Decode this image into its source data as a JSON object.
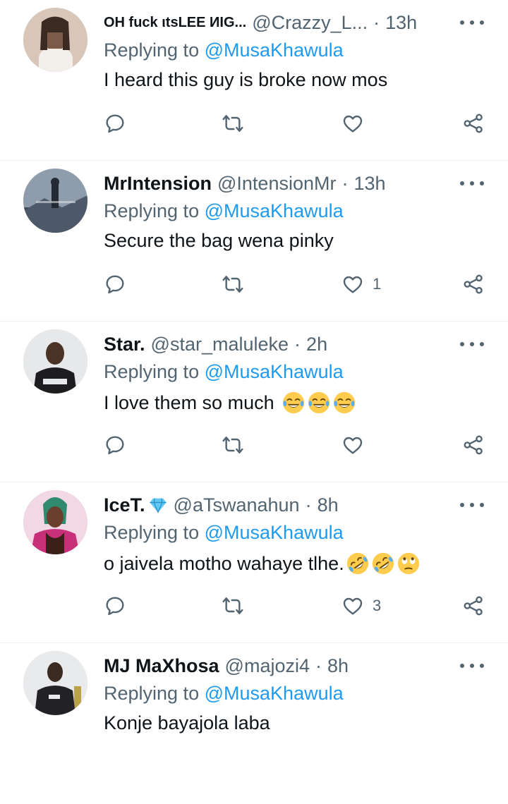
{
  "replying_label": "Replying to",
  "tweets": [
    {
      "name": "OH fuck ιtsLEE ИIG...",
      "handle": "@Crazzy_L...",
      "time": "13h",
      "mention": "@MusaKhawula",
      "text": "I heard this guy is broke now mos",
      "emojis": [],
      "likes": "",
      "avatar_colors": [
        "#d8c6b8",
        "#7a5a48"
      ]
    },
    {
      "name": "MrIntension",
      "handle": "@IntensionMr",
      "time": "13h",
      "mention": "@MusaKhawula",
      "text": "Secure the bag wena pinky",
      "emojis": [],
      "likes": "1",
      "avatar_colors": [
        "#9aa6b4",
        "#3c4654"
      ]
    },
    {
      "name": "Star.",
      "handle": "@star_maluleke",
      "time": "2h",
      "mention": "@MusaKhawula",
      "text": "I love them so much",
      "emojis": [
        "joy",
        "joy",
        "joy"
      ],
      "likes": "",
      "avatar_colors": [
        "#e6e8ea",
        "#1d1d1f"
      ]
    },
    {
      "name": "IceT.",
      "handle": "@aTswanahun",
      "time": "8h",
      "mention": "@MusaKhawula",
      "text": "o jaivela motho wahaye tlhe.",
      "emojis": [
        "rofl",
        "rofl",
        "eyeroll"
      ],
      "likes": "3",
      "verified": "diamond",
      "avatar_colors": [
        "#f2d8e4",
        "#c9307a"
      ]
    },
    {
      "name": "MJ MaXhosa",
      "handle": "@majozi4",
      "time": "8h",
      "mention": "@MusaKhawula",
      "text": "Konje bayajola laba",
      "emojis": [],
      "likes": "",
      "avatar_colors": [
        "#e8eaec",
        "#222226"
      ]
    }
  ],
  "colors": {
    "accent": "#1d9bf0",
    "muted": "#536471",
    "text": "#0f1419",
    "divider": "#eff3f4"
  },
  "icons": {
    "reply": "reply-icon",
    "retweet": "retweet-icon",
    "like": "heart-icon",
    "share": "share-icon",
    "more": "more-icon"
  }
}
